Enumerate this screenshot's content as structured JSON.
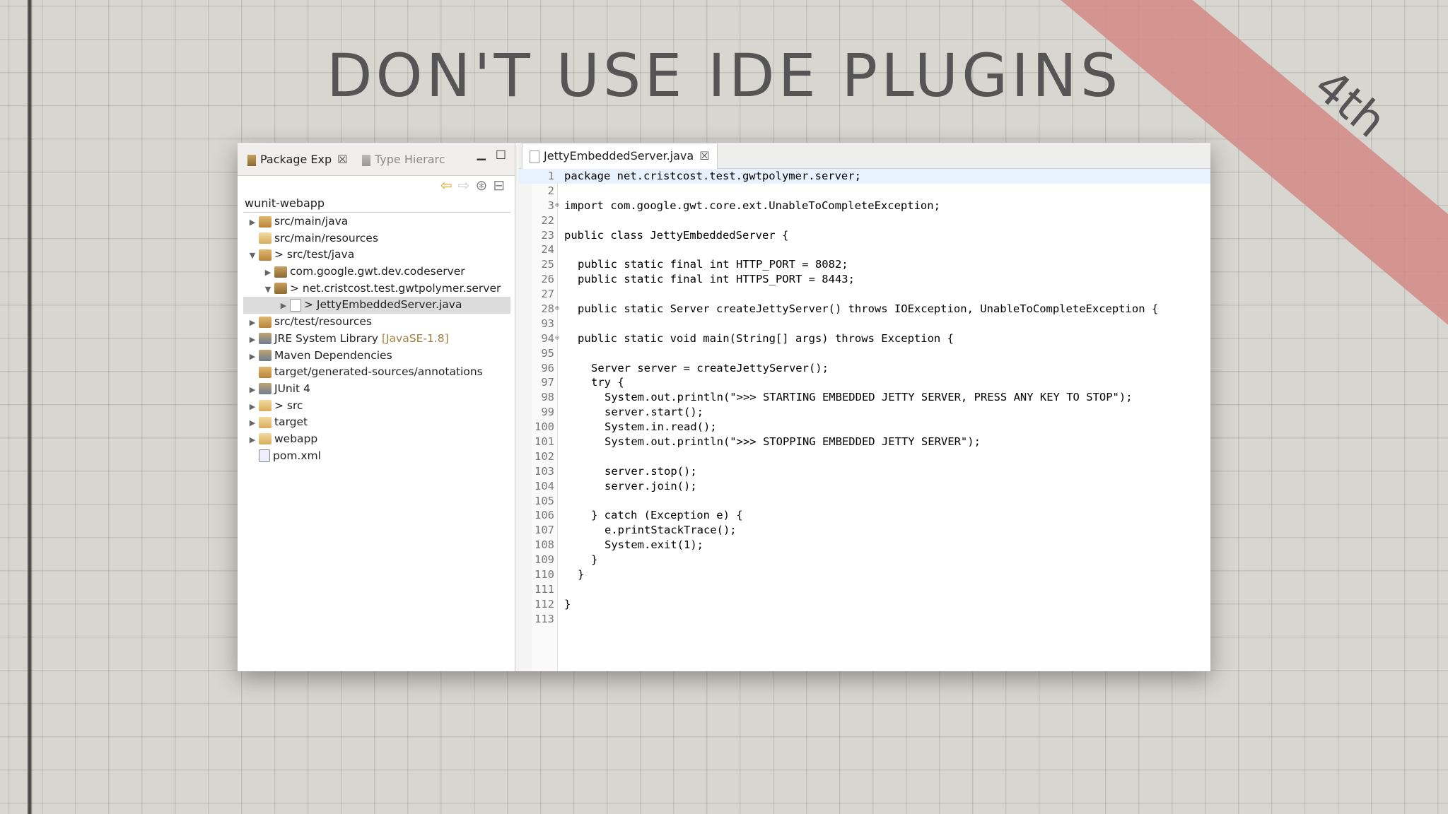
{
  "slide": {
    "title": "DON'T USE IDE PLUGINS",
    "ribbon": "4th"
  },
  "left_pane": {
    "tabs": [
      {
        "label": "Package Exp"
      },
      {
        "label": "Type Hierarc"
      }
    ],
    "project": "wunit-webapp",
    "tree": [
      {
        "label": "src/main/java"
      },
      {
        "label": "src/main/resources"
      },
      {
        "label": "> src/test/java"
      },
      {
        "label": "com.google.gwt.dev.codeserver"
      },
      {
        "label": "> net.cristcost.test.gwtpolymer.server"
      },
      {
        "label": "> JettyEmbeddedServer.java"
      },
      {
        "label": "src/test/resources"
      },
      {
        "label": "JRE System Library",
        "extra": "[JavaSE-1.8]"
      },
      {
        "label": "Maven Dependencies"
      },
      {
        "label": "target/generated-sources/annotations"
      },
      {
        "label": "JUnit 4"
      },
      {
        "label": "> src"
      },
      {
        "label": "target"
      },
      {
        "label": "webapp"
      },
      {
        "label": "pom.xml"
      }
    ]
  },
  "editor": {
    "tab": "JettyEmbeddedServer.java",
    "lines": [
      {
        "n": "1",
        "code": "package net.cristcost.test.gwtpolymer.server;"
      },
      {
        "n": "2",
        "code": ""
      },
      {
        "n": "3",
        "code": "import com.google.gwt.core.ext.UnableToCompleteException;"
      },
      {
        "n": "22",
        "code": ""
      },
      {
        "n": "23",
        "code": "public class JettyEmbeddedServer {"
      },
      {
        "n": "24",
        "code": ""
      },
      {
        "n": "25",
        "code": "public static final int HTTP_PORT = 8082;"
      },
      {
        "n": "26",
        "code": "public static final int HTTPS_PORT = 8443;"
      },
      {
        "n": "27",
        "code": ""
      },
      {
        "n": "28",
        "code": "public static Server createJettyServer() throws IOException, UnableToCompleteException {"
      },
      {
        "n": "93",
        "code": ""
      },
      {
        "n": "94",
        "code": "public static void main(String[] args) throws Exception {"
      },
      {
        "n": "95",
        "code": ""
      },
      {
        "n": "96",
        "code": "Server server = createJettyServer();"
      },
      {
        "n": "97",
        "code": "try {"
      },
      {
        "n": "98",
        "code": "System.out.println(\">>> STARTING EMBEDDED JETTY SERVER, PRESS ANY KEY TO STOP\");"
      },
      {
        "n": "99",
        "code": "server.start();"
      },
      {
        "n": "100",
        "code": "System.in.read();"
      },
      {
        "n": "101",
        "code": "System.out.println(\">>> STOPPING EMBEDDED JETTY SERVER\");"
      },
      {
        "n": "102",
        "code": ""
      },
      {
        "n": "103",
        "code": "server.stop();"
      },
      {
        "n": "104",
        "code": "server.join();"
      },
      {
        "n": "105",
        "code": ""
      },
      {
        "n": "106",
        "code": "} catch (Exception e) {"
      },
      {
        "n": "107",
        "code": "e.printStackTrace();"
      },
      {
        "n": "108",
        "code": "System.exit(1);"
      },
      {
        "n": "109",
        "code": "}"
      },
      {
        "n": "110",
        "code": "}"
      },
      {
        "n": "111",
        "code": ""
      },
      {
        "n": "112",
        "code": "}"
      },
      {
        "n": "113",
        "code": ""
      }
    ]
  }
}
